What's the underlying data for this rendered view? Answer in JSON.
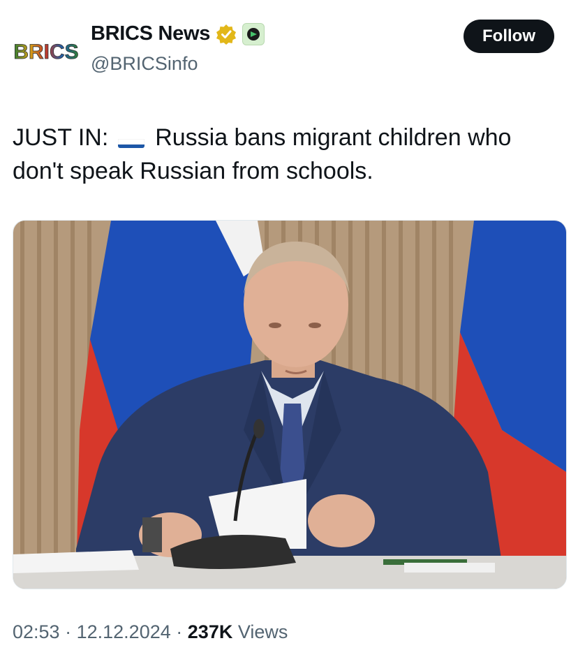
{
  "tweet": {
    "author": {
      "logo_text": "BRICS",
      "display_name": "BRICS News",
      "handle": "@BRICSinfo",
      "verified_icon": "gold-checkmark-badge-icon",
      "affiliate_icon": "green-affiliate-badge-icon"
    },
    "follow_label": "Follow",
    "text_prefix": "JUST IN:",
    "flag_icon": "russia-flag-icon",
    "text_body": "Russia bans migrant children who don't speak Russian from schools.",
    "media": {
      "scene": "man in dark suit seated at a table with microphone, holding paper, Russian flags behind"
    },
    "time": "02:53",
    "sep": "·",
    "date": "12.12.2024",
    "views_count": "237K",
    "views_label": "Views"
  },
  "colors": {
    "text_primary": "#0f1419",
    "text_secondary": "#536471",
    "follow_bg": "#0f1419",
    "verified_gold": "#e2b719"
  }
}
